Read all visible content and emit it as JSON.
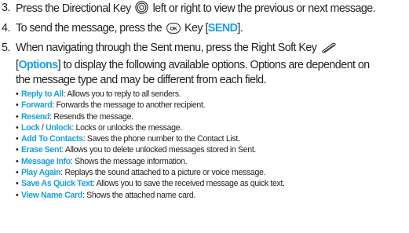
{
  "step3": {
    "num": "3.",
    "text_a": "Press the Directional Key",
    "text_b": "left or right to view the previous or next message."
  },
  "step4": {
    "num": "4.",
    "text_a": "To send the message, press the",
    "text_b": "Key [",
    "key": "SEND",
    "text_c": "]."
  },
  "step5": {
    "num": "5.",
    "line1_text": "When navigating through the Sent menu, press the Right Soft Key",
    "bracket_open": "[",
    "key": "Options",
    "line2_rest": "] to display the following available options. Options are dependent on",
    "line3": "the message type and may be different from each field."
  },
  "icons": {
    "directional": "directional-key-icon",
    "ok": "ok-key-icon",
    "soft": "right-soft-key-icon"
  },
  "colors": {
    "accent": "#1ca0d8",
    "text": "#231f20"
  },
  "options": [
    {
      "name": "Reply to All",
      "desc": ": Allows you to reply to all senders."
    },
    {
      "name": "Forward",
      "desc": ": Forwards the message to another recipient."
    },
    {
      "name": "Resend",
      "desc": ": Resends the message."
    },
    {
      "name": "Lock",
      "sep": " / ",
      "name2": "Unlock",
      "desc": ": Locks or unlocks the message."
    },
    {
      "name": "Add To Contacts",
      "desc": ": Saves the phone number to the Contact List."
    },
    {
      "name": "Erase Sent",
      "desc": ": Allows you to delete unlocked messages stored in Sent."
    },
    {
      "name": "Message Info",
      "desc": ": Shows the message information."
    },
    {
      "name": "Play Again",
      "desc": ": Replays the sound attached to a picture or voice message."
    },
    {
      "name": "Save As Quick Text",
      "desc": ": Allows you to save the received message as quick text."
    },
    {
      "name": "View Name Card",
      "desc": ": Shows the attached name card."
    }
  ]
}
